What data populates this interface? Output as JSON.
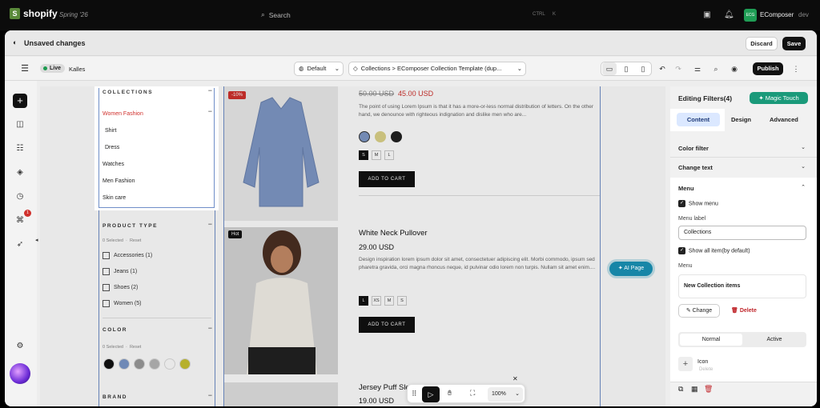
{
  "topbar": {
    "brand": "shopify",
    "season": "Spring '26",
    "search_label": "Search",
    "kbd_ctrl": "CTRL",
    "kbd_k": "K",
    "avatar_initials": "ECG",
    "shop_name": "EComposer",
    "env": "dev"
  },
  "unsaved": {
    "title": "Unsaved changes",
    "discard": "Discard",
    "save": "Save"
  },
  "toolbar": {
    "live": "Live",
    "theme": "Kalles",
    "default_label": "Default",
    "template_label": "Collections > EComposer Collection Template (dup...",
    "publish": "Publish"
  },
  "sidebar": {
    "collections_title": "COLLECTIONS",
    "collections": [
      "Women Fashion",
      "Shirt",
      "Dress",
      "Watches",
      "Men Fashion",
      "Skin care"
    ],
    "product_type_title": "PRODUCT TYPE",
    "selected_text": "0 Selected",
    "reset": "Reset",
    "product_types": [
      "Accessories (1)",
      "Jeans (1)",
      "Shoes (2)",
      "Women (5)"
    ],
    "color_title": "COLOR",
    "color_selected": "0 Selected",
    "color_reset": "Reset",
    "swatches": [
      "#111111",
      "#7a97c8",
      "#9a9a9a",
      "#b7b7b7",
      "#ffffff",
      "#c8c230"
    ],
    "brand_title": "BRAND"
  },
  "products": [
    {
      "badge": "-10%",
      "old_price": "50.00 USD",
      "price": "45.00 USD",
      "desc": "The point of using Lorem Ipsum is that it has a more-or-less normal distribution of letters. On the other hand, we denounce with righteous indignation and dislike men who are...",
      "sizes": [
        "S",
        "M",
        "L"
      ],
      "cta": "ADD TO CART"
    },
    {
      "badge": "Hot",
      "title": "White Neck Pullover",
      "price": "29.00 USD",
      "desc": "Design inspiration lorem ipsum dolor sit amet, consectetuer adipiscing elit. Morbi commodo, ipsum sed pharetra gravida, orci magna rhoncus neque, id pulvinar odio lorem non turpis. Nullam sit amet enim....",
      "sizes": [
        "L",
        "XS",
        "M",
        "S"
      ],
      "cta": "ADD TO CART"
    },
    {
      "title": "Jersey Puff Sleeve",
      "price": "19.00 USD"
    }
  ],
  "ai_page": "AI Page",
  "zoom": "100%",
  "colors": {
    "sale": "#d0312d",
    "accent": "#1786a7",
    "magic": "#1a9a7a"
  },
  "panel": {
    "title": "Editing Filters(4)",
    "magic": "Magic Touch",
    "tabs": [
      "Content",
      "Design",
      "Advanced"
    ],
    "color_filter": "Color filter",
    "change_text": "Change text",
    "menu_title": "Menu",
    "show_menu": "Show menu",
    "menu_label_caption": "Menu label",
    "menu_label_value": "Collections",
    "show_all": "Show all item(by default)",
    "menu_caption": "Menu",
    "new_collection": "New Collection items",
    "change": "Change",
    "delete": "Delete",
    "state_tabs": [
      "Normal",
      "Active"
    ],
    "icon_label": "Icon",
    "icon_sub": "Delete"
  }
}
